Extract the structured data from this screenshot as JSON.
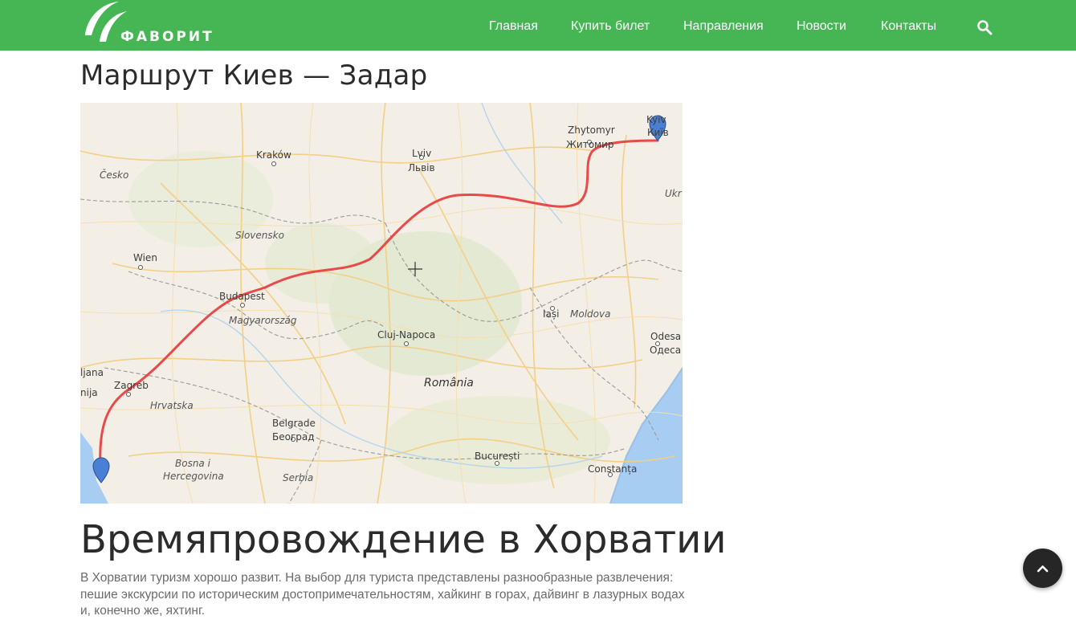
{
  "brand": {
    "name": "ФАВОРИТ",
    "accent": "#45b653"
  },
  "nav": {
    "items": [
      "Главная",
      "Купить билет",
      "Направления",
      "Новости",
      "Контакты"
    ],
    "search_icon": "search-icon"
  },
  "page": {
    "route_title": "Маршрут Киев — Задар",
    "section_title": "Времяпровождение в Хорватии",
    "section_text": "В Хорватии туризм хорошо развит. На выбор для туриста представлены разнообразные развлечения: пешие экскурсии по историческим достопримечательностям, хайкинг в горах, дайвинг в лазурных водах и, конечно же, яхтинг."
  },
  "map": {
    "route_color": "#e84a4a",
    "labels": {
      "zhytomyr": "Zhytomyr",
      "zhytomyr_cyr": "Житомир",
      "kyiv": "Kyiv",
      "kyiv_cyr": "Київ",
      "ukr": "Ukr",
      "krakow": "Kraków",
      "lviv": "Lviv",
      "lviv_cyr": "Львів",
      "cesko": "Česko",
      "slovensko": "Slovensko",
      "wien": "Wien",
      "budapest": "Budapest",
      "magyarorszag": "Magyarország",
      "cluj": "Cluj-Napoca",
      "iasi": "Iași",
      "moldova": "Moldova",
      "odesa": "Odesa",
      "odesa_cyr": "Одеса",
      "romania": "România",
      "ljana": "ljana",
      "nija": "nija",
      "zagreb": "Zagreb",
      "hrvatska": "Hrvatska",
      "belgrade": "Belgrade",
      "belgrade_cyr": "Београд",
      "bosna": "Bosna i",
      "hercegovina": "Hercegovina",
      "serbia": "Serbia",
      "bucuresti": "București",
      "constanta": "Constanța"
    }
  },
  "back_to_top": {
    "icon": "chevron-up-icon"
  }
}
